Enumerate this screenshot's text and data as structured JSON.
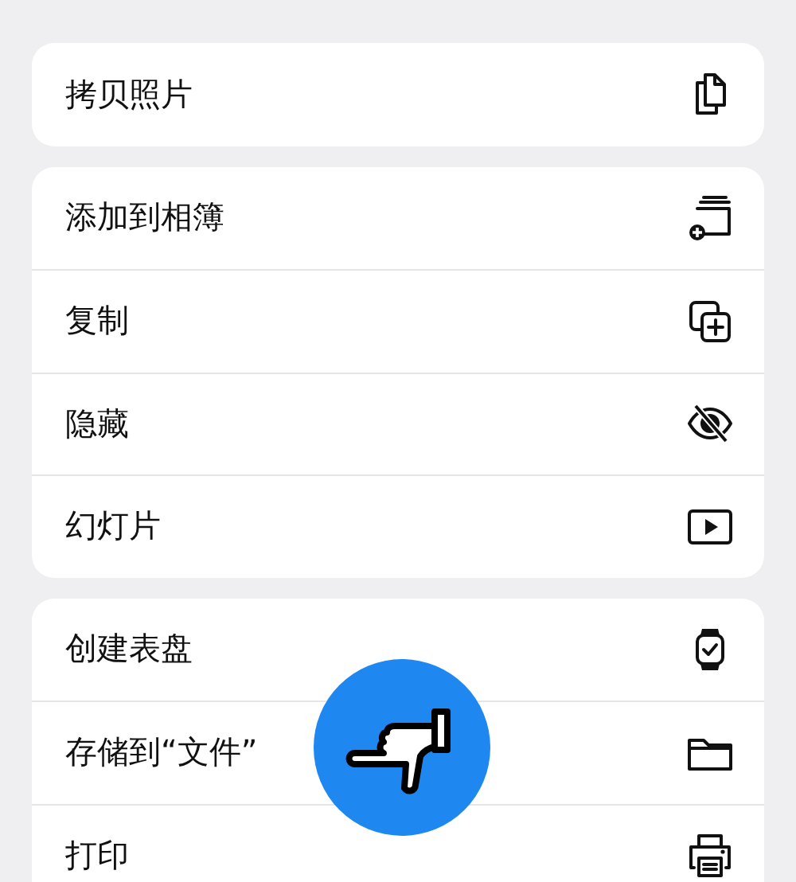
{
  "groups": [
    {
      "items": [
        {
          "label": "拷贝照片",
          "kind": "copy"
        }
      ]
    },
    {
      "items": [
        {
          "label": "添加到相簿",
          "kind": "album"
        },
        {
          "label": "复制",
          "kind": "duplicate"
        },
        {
          "label": "隐藏",
          "kind": "hide"
        },
        {
          "label": "幻灯片",
          "kind": "slideshow"
        }
      ]
    },
    {
      "items": [
        {
          "label": "创建表盘",
          "kind": "watch"
        },
        {
          "label": "存储到“文件”",
          "kind": "folder"
        },
        {
          "label": "打印",
          "kind": "print"
        }
      ]
    }
  ]
}
